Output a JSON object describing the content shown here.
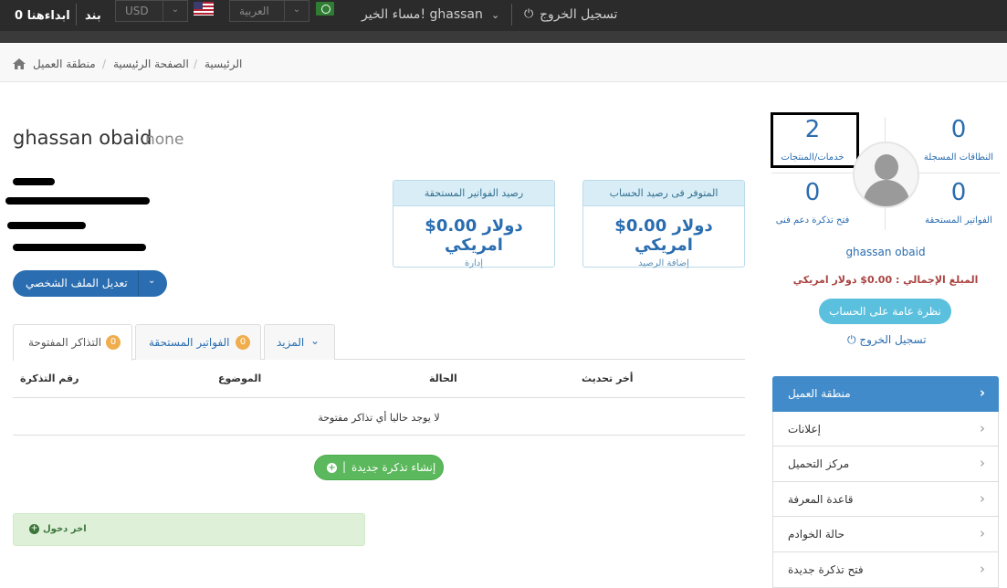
{
  "topbar": {
    "cart": "ابداءهنا 0",
    "brand": "بند",
    "currency": "USD",
    "language": "العربية",
    "greeting": "مساء الخير! ghassan",
    "logout": "تسجيل الخروج"
  },
  "breadcrumb": [
    "منطقة العميل",
    "الصفحة الرئيسية",
    "الرئيسية"
  ],
  "profile": {
    "name": "ghassan obaid",
    "company": "none"
  },
  "edit_profile_label": "تعديل الملف الشخصي",
  "stats": [
    {
      "header": "رصيد الفواتير المستحقة",
      "amount": "$0.00 دولار امريكي",
      "footer": "إدارة"
    },
    {
      "header": "المتوفر فى رصيد الحساب",
      "amount": "$0.00 دولار امريكي",
      "footer": "إضافة الرصيد"
    }
  ],
  "tabs": [
    {
      "label": "التذاكر المفتوحة",
      "badge": "0"
    },
    {
      "label": "الفواتير المستحقة",
      "badge": "0"
    },
    {
      "label": "المزيد"
    }
  ],
  "table": {
    "headers": [
      "رقم التذكرة",
      "الموضوع",
      "الحالة",
      "أخر تحديث"
    ],
    "empty": "لا يوجد حاليا أي تذاكر مفتوحة"
  },
  "new_ticket_label": "إنشاء تذكرة جديدة",
  "last_login_label": "اخر دخول",
  "sidebar": {
    "counters": [
      {
        "value": "2",
        "label": "خدمات/المنتجات"
      },
      {
        "value": "0",
        "label": "النطاقات المسجلة"
      },
      {
        "value": "0",
        "label": "فتح تذكرة دعم فنى"
      },
      {
        "value": "0",
        "label": "الفواتير المستحقة"
      }
    ],
    "name": "ghassan obaid",
    "total": "المبلغ الإجمالي : 0.00$ دولار امريكي",
    "overview": "نظرة عامة على الحساب",
    "logout": "تسجيل الخروج",
    "menu": [
      "منطقة العميل",
      "إعلانات",
      "مركز التحميل",
      "قاعدة المعرفة",
      "حالة الخوادم",
      "فتح تذكرة جديدة"
    ]
  },
  "colors": {
    "primary": "#2a6db0",
    "success": "#5cb85c",
    "info": "#5bc0de",
    "warning": "#f0ad4e",
    "danger": "#a94442"
  }
}
